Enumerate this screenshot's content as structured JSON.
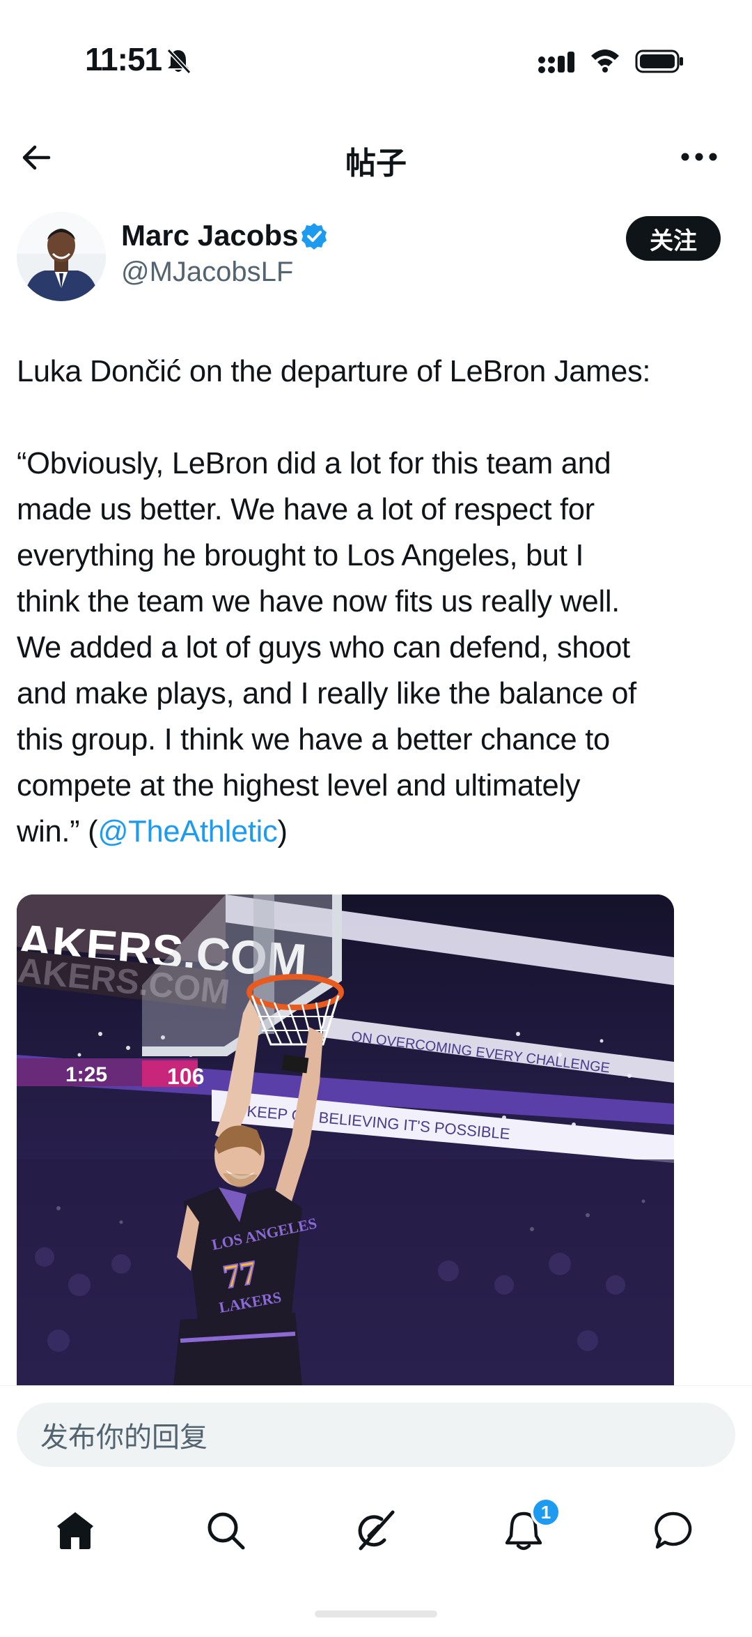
{
  "status_bar": {
    "time": "11:51",
    "icons": [
      "bell-off-icon",
      "signal-icon",
      "wifi-icon",
      "battery-icon"
    ]
  },
  "nav": {
    "title": "帖子",
    "back_icon": "arrow-left-icon",
    "more_icon": "more-horizontal-icon"
  },
  "author": {
    "name": "Marc Jacobs",
    "handle": "@MJacobsLF",
    "verified": true,
    "follow_label": "关注"
  },
  "tweet": {
    "intro": "Luka Dončić on the departure of LeBron James:",
    "quote_lines": [
      "“Obviously, LeBron did a lot for this team and",
      "made us better. We have a lot of respect for",
      "everything he brought to Los Angeles, but I",
      "think the team we have now fits us really well.",
      "We added a lot of guys who can defend, shoot",
      "and make plays, and I really like the balance of",
      "this group. I think we have a better chance to",
      "compete at the highest level and ultimately"
    ],
    "last_line_prefix": "win.” (",
    "mention": "@TheAthletic",
    "last_line_suffix": ")"
  },
  "media": {
    "banner_text": "AKERS.COM",
    "banner_text_reflection": "AKERS.COM",
    "scoreboard_time": "1:25",
    "scoreboard_score": "106",
    "led_text_1": "KEEP ON BELIEVING IT'S POSSIBLE",
    "led_text_2": "ON OVERCOMING EVERY CHALLENGE",
    "jersey_text": "LOS ANGELES",
    "jersey_number": "77",
    "shorts_text": "LAKERS"
  },
  "reply": {
    "placeholder": "发布你的回复"
  },
  "tabs": [
    {
      "icon": "home-icon",
      "active": true
    },
    {
      "icon": "search-icon",
      "active": false
    },
    {
      "icon": "grok-icon",
      "active": false
    },
    {
      "icon": "notifications-icon",
      "active": false,
      "badge": "1"
    },
    {
      "icon": "messages-icon",
      "active": false
    }
  ],
  "colors": {
    "accent": "#1d9bf0",
    "text": "#0f1419",
    "secondary_text": "#536471",
    "follow_button": "#0f1419"
  }
}
